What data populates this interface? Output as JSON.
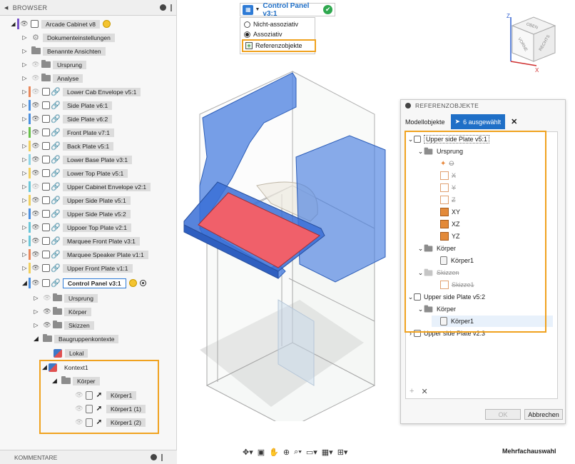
{
  "browser": {
    "title": "BROWSER",
    "items": [
      {
        "label": "Arcade Cabinet v8"
      },
      {
        "label": "Dokumenteinstellungen"
      },
      {
        "label": "Benannte Ansichten"
      },
      {
        "label": "Ursprung"
      },
      {
        "label": "Analyse"
      },
      {
        "label": "Lower Cab Envelope v5:1"
      },
      {
        "label": "Side Plate v6:1"
      },
      {
        "label": "Side Plate v6:2"
      },
      {
        "label": "Front Plate v7:1"
      },
      {
        "label": "Back Plate v5:1"
      },
      {
        "label": "Lower Base Plate v3:1"
      },
      {
        "label": "Lower Top Plate v5:1"
      },
      {
        "label": "Upper Cabinet Envelope v2:1"
      },
      {
        "label": "Upper Side Plate v5:1"
      },
      {
        "label": "Upper Side Plate v5:2"
      },
      {
        "label": "Uppoer Top Plate v2:1"
      },
      {
        "label": "Marquee Front Plate v3:1"
      },
      {
        "label": "Marquee Speaker Plate v1:1"
      },
      {
        "label": "Upper Front Plate v1:1"
      },
      {
        "label": "Control Panel v3:1"
      },
      {
        "label": "Ursprung"
      },
      {
        "label": "Körper"
      },
      {
        "label": "Skizzen"
      },
      {
        "label": "Baugruppenkontexte"
      },
      {
        "label": "Lokal"
      },
      {
        "label": "Kontext1"
      },
      {
        "label": "Körper"
      },
      {
        "label": "Körper1"
      },
      {
        "label": "Körper1 (1)"
      },
      {
        "label": "Körper1 (2)"
      }
    ],
    "bar_colors": {
      "arcade": "#7a55c8",
      "lower_cab": "#e9875a",
      "side1": "#4a8fe0",
      "side2": "#4a8fe0",
      "front": "#67c04a",
      "back": "#f0d060",
      "lower_base": "#8fd4e6",
      "lower_top": "#f0d060",
      "upper_env": "#6ac7d9",
      "upper_side1": "#f0d060",
      "upper_side2": "#4a8fe0",
      "uppoer_top": "#6ac7d9",
      "marquee_front": "#6ac7d9",
      "marquee_speaker": "#e9875a",
      "upper_front": "#f0d060"
    }
  },
  "comments": {
    "title": "KOMMENTARE"
  },
  "control_panel": {
    "title": "Control Panel v3:1",
    "options": [
      "Nicht-assoziativ",
      "Assoziativ"
    ],
    "selected_option": "Assoziativ",
    "ref_button": "Referenzobjekte"
  },
  "viewcube": {
    "top": "OBEN",
    "front": "VORNE",
    "right": "RECHTS",
    "axis_x": "X",
    "axis_z": "Z"
  },
  "ref_panel": {
    "title": "REFERENZOBJEKTE",
    "tab_models": "Modellobjekte",
    "tab_selected": "6 ausgewählt",
    "tree": [
      {
        "label": "Upper side Plate v5:1"
      },
      {
        "label": "Ursprung"
      },
      {
        "label": "O"
      },
      {
        "label": "X"
      },
      {
        "label": "Y"
      },
      {
        "label": "Z"
      },
      {
        "label": "XY"
      },
      {
        "label": "XZ"
      },
      {
        "label": "YZ"
      },
      {
        "label": "Körper"
      },
      {
        "label": "Körper1"
      },
      {
        "label": "Skizzen"
      },
      {
        "label": "Skizze1"
      },
      {
        "label": "Upper side Plate v5:2"
      },
      {
        "label": "Körper"
      },
      {
        "label": "Körper1"
      },
      {
        "label": "Upper side Plate v2:3"
      }
    ],
    "ok": "OK",
    "cancel": "Abbrechen"
  },
  "status": {
    "mode": "Mehrfachauswahl"
  },
  "colors": {
    "accent": "#1f6fc7",
    "highlight": "#f0a21f",
    "model_blue": "#4a7fe0",
    "model_red": "#f0606a"
  }
}
